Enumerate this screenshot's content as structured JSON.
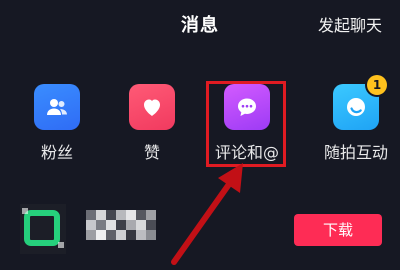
{
  "header": {
    "title": "消息",
    "start_chat": "发起聊天"
  },
  "categories": [
    {
      "label": "粉丝",
      "icon": "fans-icon",
      "color": "#2f6cf5"
    },
    {
      "label": "赞",
      "icon": "heart-icon",
      "color": "#f13a5f"
    },
    {
      "label": "评论和@",
      "icon": "comment-bubble-icon",
      "color": "#9d3bf5"
    },
    {
      "label": "随拍互动",
      "icon": "circle-interaction-icon",
      "color": "#1fa3f5",
      "badge": "1"
    }
  ],
  "app_row": {
    "download_label": "下载"
  },
  "colors": {
    "background": "#161823",
    "accent": "#fe2c55",
    "annotation": "#e01b22",
    "badge": "#ffc11d"
  }
}
